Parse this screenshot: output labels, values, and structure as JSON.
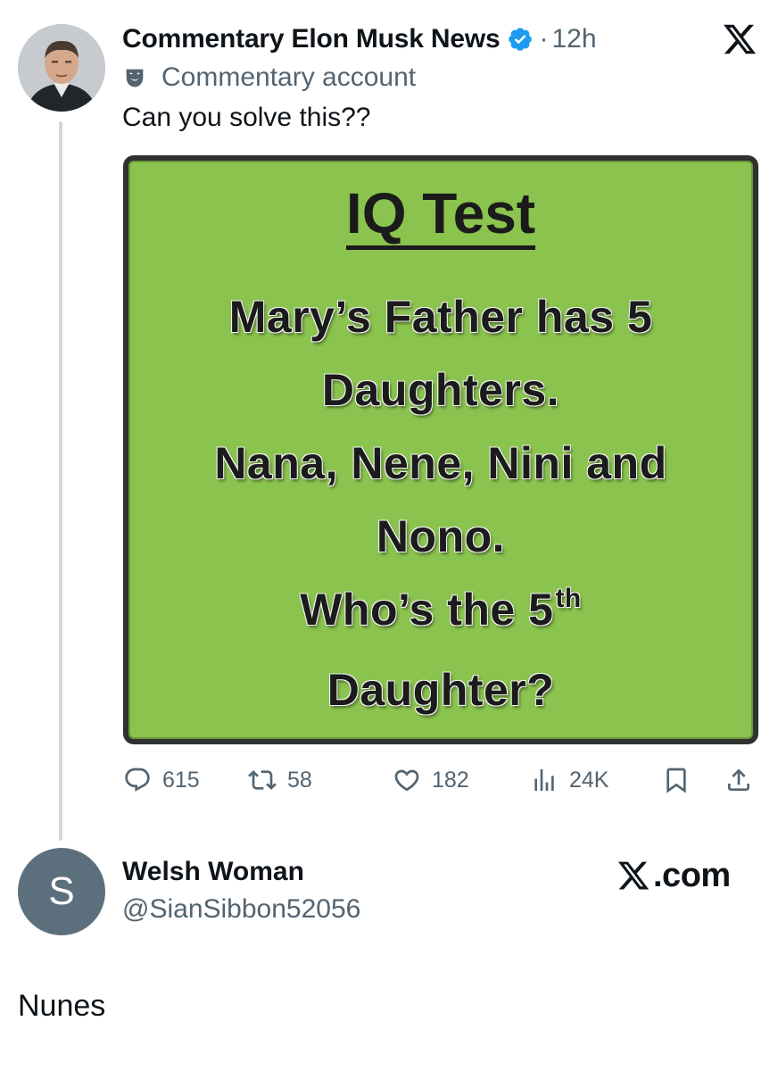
{
  "tweet": {
    "author_name": "Commentary Elon Musk News",
    "time": "12h",
    "dot": "·",
    "commentary_label": "Commentary account",
    "text": "Can you solve this??",
    "verified_color": "#1d9bf0"
  },
  "meme": {
    "title": "IQ Test",
    "lines": [
      "Mary’s Father has 5",
      "Daughters.",
      "Nana, Nene, Nini and",
      "Nono."
    ],
    "question_prefix": "Who’s the 5",
    "question_sup": "th",
    "question_end": "Daughter?",
    "background_color": "#8bc34f"
  },
  "actions": {
    "replies": "615",
    "reposts": "58",
    "likes": "182",
    "views": "24K"
  },
  "reply": {
    "avatar_letter": "S",
    "name": "Welsh Woman",
    "handle": "@SianSibbon52056",
    "source_suffix": ".com",
    "text": "Nunes"
  },
  "icons": [
    "x-logo-icon",
    "verified-badge-icon",
    "commentary-mask-icon",
    "reply-icon",
    "repost-icon",
    "like-icon",
    "views-icon",
    "bookmark-icon",
    "share-icon"
  ]
}
